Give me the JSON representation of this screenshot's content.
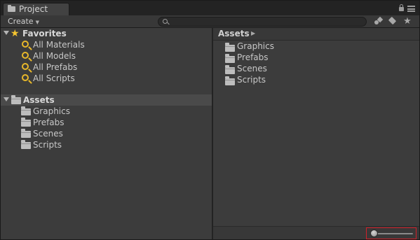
{
  "tab": {
    "label": "Project"
  },
  "toolbar": {
    "create_label": "Create",
    "search": {
      "value": "",
      "placeholder": ""
    },
    "icons": [
      "filter-by-type-icon",
      "filter-by-label-icon",
      "favorites-star-icon"
    ]
  },
  "favorites": {
    "label": "Favorites",
    "items": [
      {
        "label": "All Materials"
      },
      {
        "label": "All Models"
      },
      {
        "label": "All Prefabs"
      },
      {
        "label": "All Scripts"
      }
    ]
  },
  "assets_tree": {
    "label": "Assets",
    "items": [
      {
        "label": "Graphics"
      },
      {
        "label": "Prefabs"
      },
      {
        "label": "Scenes"
      },
      {
        "label": "Scripts"
      }
    ]
  },
  "right_pane": {
    "breadcrumb": "Assets",
    "breadcrumb_arrow": "▶",
    "items": [
      {
        "label": "Graphics"
      },
      {
        "label": "Prefabs"
      },
      {
        "label": "Scenes"
      },
      {
        "label": "Scripts"
      }
    ]
  },
  "zoom_slider": {
    "value": 0
  },
  "colors": {
    "highlight_border": "#d0202a",
    "favorite_icon": "#e8b82a"
  }
}
